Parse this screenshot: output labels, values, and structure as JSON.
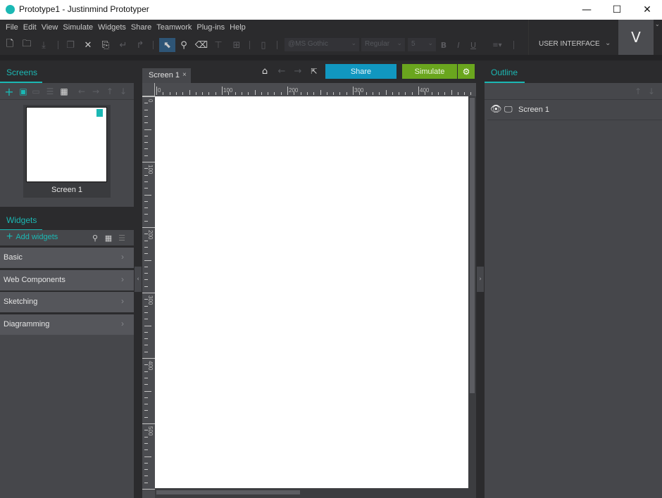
{
  "window": {
    "title": "Prototype1 - Justinmind Prototyper",
    "controls": {
      "minimize": "—",
      "maximize": "☐",
      "close": "✕"
    }
  },
  "menu": [
    "File",
    "Edit",
    "View",
    "Simulate",
    "Widgets",
    "Share",
    "Teamwork",
    "Plug-ins",
    "Help"
  ],
  "toolbar": {
    "icons": [
      "new-file-icon",
      "open-folder-icon",
      "save-icon",
      "copy-icon",
      "cut-icon",
      "paste-icon",
      "undo-icon",
      "redo-icon",
      "select-icon",
      "zoom-icon",
      "eraser-icon",
      "format-painter-icon",
      "format-painter-all-icon",
      "device-icon"
    ],
    "font_family": "@MS Gothic",
    "font_style": "Regular",
    "font_size": "5",
    "bold": "B",
    "italic": "I",
    "underline": "U",
    "align": "≡▾"
  },
  "ui_mode": {
    "label": "USER INTERFACE"
  },
  "user": {
    "initial": "V"
  },
  "screens_panel": {
    "tab": "Screens",
    "screens": [
      {
        "name": "Screen 1"
      }
    ]
  },
  "widgets_panel": {
    "tab": "Widgets",
    "add_label": "Add widgets",
    "categories": [
      "Basic",
      "Web Components",
      "Sketching",
      "Diagramming"
    ]
  },
  "editor": {
    "tab_label": "Screen 1",
    "tab_close": "×",
    "share_label": "Share",
    "simulate_label": "Simulate",
    "h_ruler_labels": [
      "0",
      "100",
      "200",
      "300",
      "400"
    ],
    "v_ruler_labels": [
      "0",
      "100",
      "200",
      "300",
      "400",
      "500"
    ]
  },
  "outline_panel": {
    "tab": "Outline",
    "items": [
      {
        "label": "Screen 1"
      }
    ]
  },
  "colors": {
    "accent": "#1bb8b4",
    "share": "#1197c0",
    "simulate": "#6aa61e",
    "panel_bg": "#46474b",
    "app_bg": "#2b2b2d"
  }
}
